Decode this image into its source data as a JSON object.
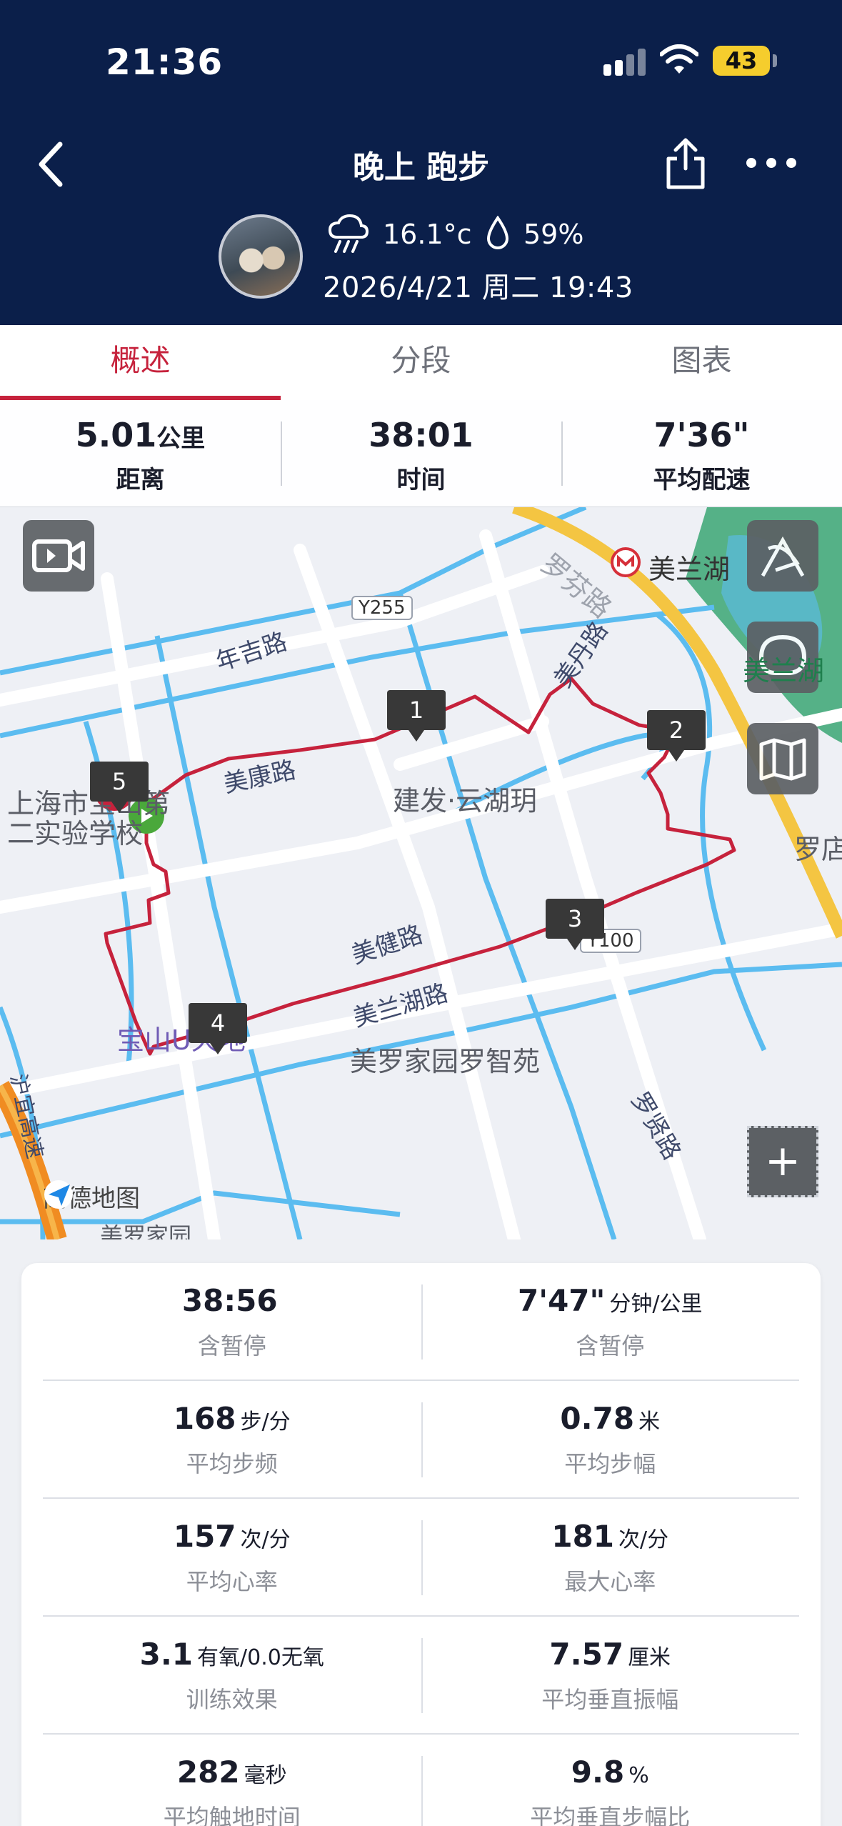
{
  "status_bar": {
    "time": "21:36",
    "battery": "43"
  },
  "header": {
    "title": "晚上 跑步",
    "temperature": "16.1°c",
    "humidity": "59%",
    "datetime": "2026/4/21 周二 19:43"
  },
  "tabs": [
    {
      "label": "概述",
      "active": true
    },
    {
      "label": "分段",
      "active": false
    },
    {
      "label": "图表",
      "active": false
    }
  ],
  "summary": [
    {
      "value": "5.01",
      "unit": "公里",
      "label": "距离"
    },
    {
      "value": "38:01",
      "unit": "",
      "label": "时间"
    },
    {
      "value": "7'36\"",
      "unit": "",
      "label": "平均配速"
    }
  ],
  "map": {
    "places": {
      "school": "上海市宝山第二实验学校",
      "complex": "建发·云湖玥",
      "lake_station": "美兰湖",
      "lake": "美兰湖",
      "luodian": "罗店",
      "garden": "美罗家园罗智苑",
      "mall": "宝山U天地",
      "bottom": "美罗家园"
    },
    "roads": {
      "nianji": "年吉路",
      "meikang": "美康路",
      "meidan": "美丹路",
      "luofen": "罗芬路",
      "meijian": "美健路",
      "meilanhu": "美兰湖路",
      "luoxian": "罗贤路",
      "highway": "沪宜高速"
    },
    "road_tags": {
      "y255": "Y255",
      "y100": "Y100"
    },
    "laps": [
      "1",
      "2",
      "3",
      "4",
      "5"
    ],
    "provider": "高德地图",
    "zoom_label": "+"
  },
  "stats": [
    [
      {
        "value": "38:56",
        "unit": "",
        "label": "含暂停"
      },
      {
        "value": "7'47\"",
        "unit": "分钟/公里",
        "label": "含暂停"
      }
    ],
    [
      {
        "value": "168",
        "unit": "步/分",
        "label": "平均步频"
      },
      {
        "value": "0.78",
        "unit": "米",
        "label": "平均步幅"
      }
    ],
    [
      {
        "value": "157",
        "unit": "次/分",
        "label": "平均心率"
      },
      {
        "value": "181",
        "unit": "次/分",
        "label": "最大心率"
      }
    ],
    [
      {
        "value": "3.1",
        "unit": "有氧/0.0无氧",
        "label": "训练效果"
      },
      {
        "value": "7.57",
        "unit": "厘米",
        "label": "平均垂直振幅"
      }
    ],
    [
      {
        "value": "282",
        "unit": "毫秒",
        "label": "平均触地时间"
      },
      {
        "value": "9.8",
        "unit": "%",
        "label": "平均垂直步幅比"
      }
    ]
  ],
  "colors": {
    "header_bg": "#0b1f4a",
    "accent": "#c6223c",
    "route": "#c6223c",
    "water": "#5bbcf0"
  }
}
